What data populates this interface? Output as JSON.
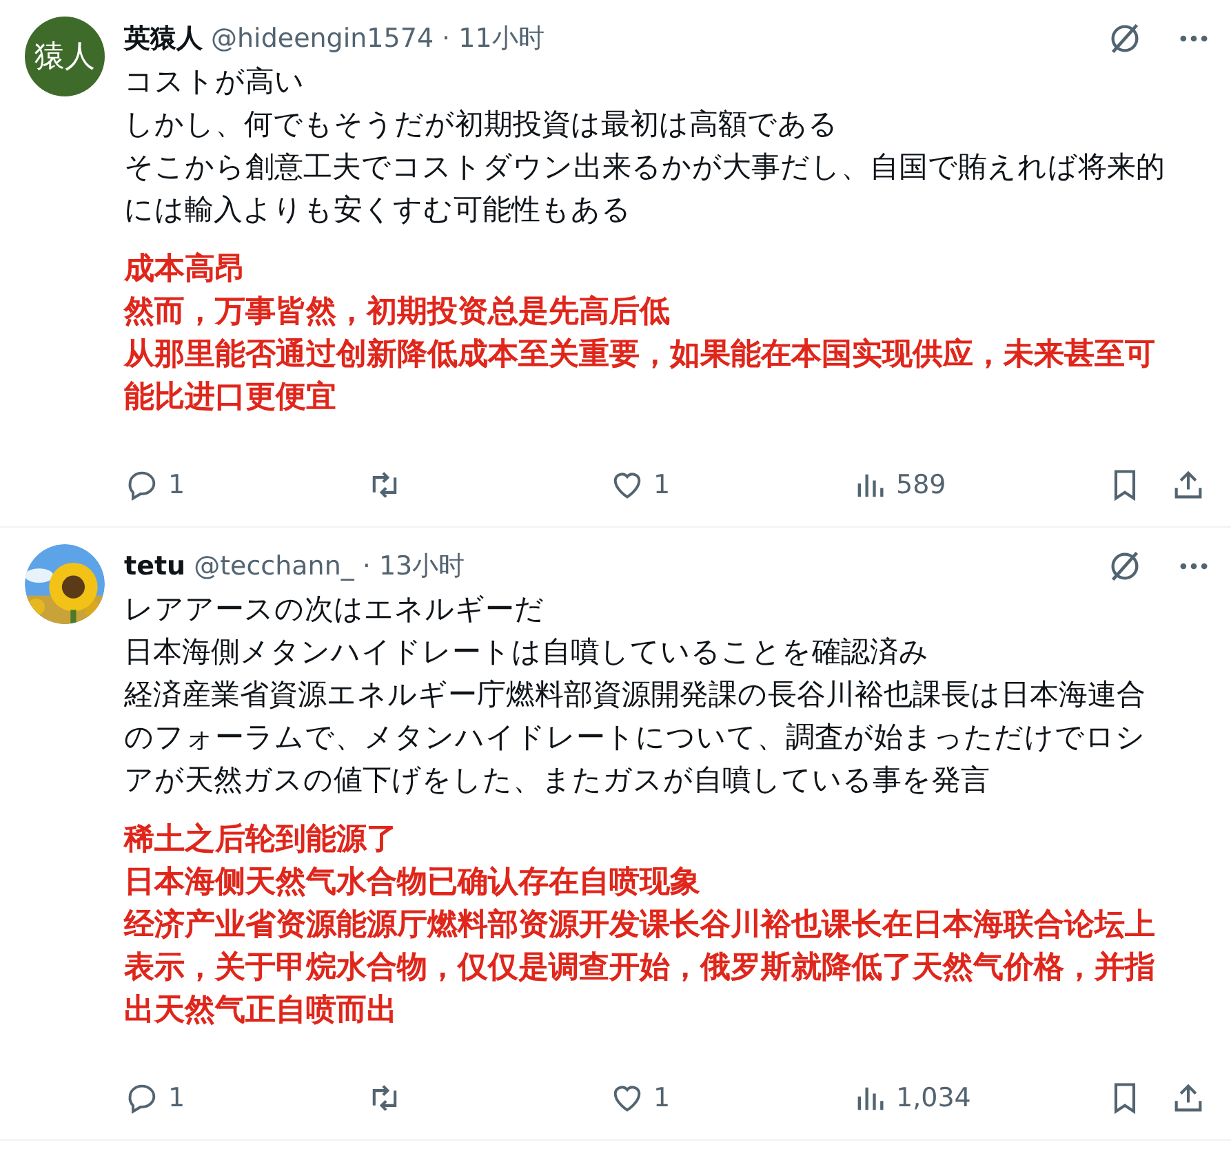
{
  "posts": [
    {
      "avatar": {
        "kind": "text",
        "text": "猿人"
      },
      "name": "英猿人",
      "handle": "@hideengin1574",
      "time": "· 11小时",
      "lines": [
        "コストが高い",
        "しかし、何でもそうだが初期投資は最初は高額である",
        "そこから創意工夫でコストダウン出来るかが大事だし、自国で賄えれば将来的には輸入よりも安くすむ可能性もある"
      ],
      "translation": [
        "成本高昂",
        "然而，万事皆然，初期投资总是先高后低",
        "从那里能否通过创新降低成本至关重要，如果能在本国实现供应，未来甚至可能比进口更便宜"
      ],
      "replies": "1",
      "likes": "1",
      "views": "589"
    },
    {
      "name": "tetu",
      "handle": "@tecchann_",
      "time": "· 13小时",
      "lines": [
        "レアアースの次はエネルギーだ",
        "日本海側メタンハイドレートは自噴していることを確認済み",
        "経済産業省資源エネルギー庁燃料部資源開発課の長谷川裕也課長は日本海連合のフォーラムで、メタンハイドレートについて、調査が始まっただけでロシアが天然ガスの値下げをした、またガスが自噴している事を発言"
      ],
      "translation": [
        "稀土之后轮到能源了",
        "日本海侧天然气水合物已确认存在自喷现象",
        "经济产业省资源能源厅燃料部资源开发课长谷川裕也课长在日本海联合论坛上表示，关于甲烷水合物，仅仅是调查开始，俄罗斯就降低了天然气价格，并指出天然气正自喷而出"
      ],
      "replies": "1",
      "likes": "1",
      "views": "1,034"
    }
  ]
}
